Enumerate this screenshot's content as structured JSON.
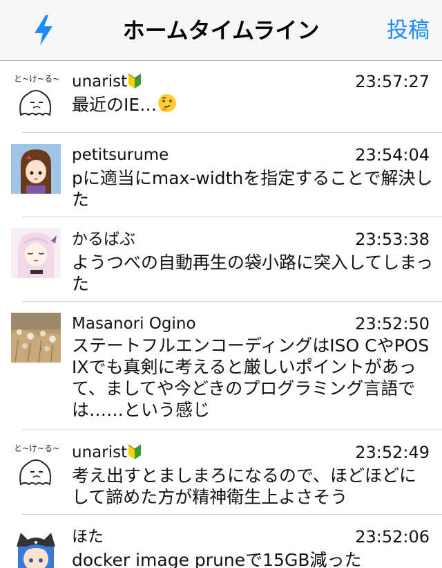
{
  "nav": {
    "title": "ホームタイムライン",
    "right_label": "投稿",
    "left_icon": "lightning-icon",
    "accent": "#1a8cff"
  },
  "posts": [
    {
      "user": "unarist",
      "badge": "beginner-badge",
      "time": "23:57:27",
      "body": "最近のIE…",
      "body_emoji": "thinking-face"
    },
    {
      "user": "petitsurume",
      "time": "23:54:04",
      "body": "pに適当にmax-widthを指定することで解決した"
    },
    {
      "user": "かるばぶ",
      "time": "23:53:38",
      "body": "ようつべの自動再生の袋小路に突入してしまった"
    },
    {
      "user": "Masanori Ogino",
      "time": "23:52:50",
      "body": "ステートフルエンコーディングはISO CやPOSIXでも真剣に考えると厳しいポイントがあって、ましてや今どきのプログラミング言語では……という感じ"
    },
    {
      "user": "unarist",
      "badge": "beginner-badge",
      "time": "23:52:49",
      "body": "考え出すとましまろになるので、ほどほどにして諦めた方が精神衛生上よさそう"
    },
    {
      "user": "ほた",
      "time": "23:52:06",
      "body": "docker image pruneで15GB減った"
    }
  ]
}
